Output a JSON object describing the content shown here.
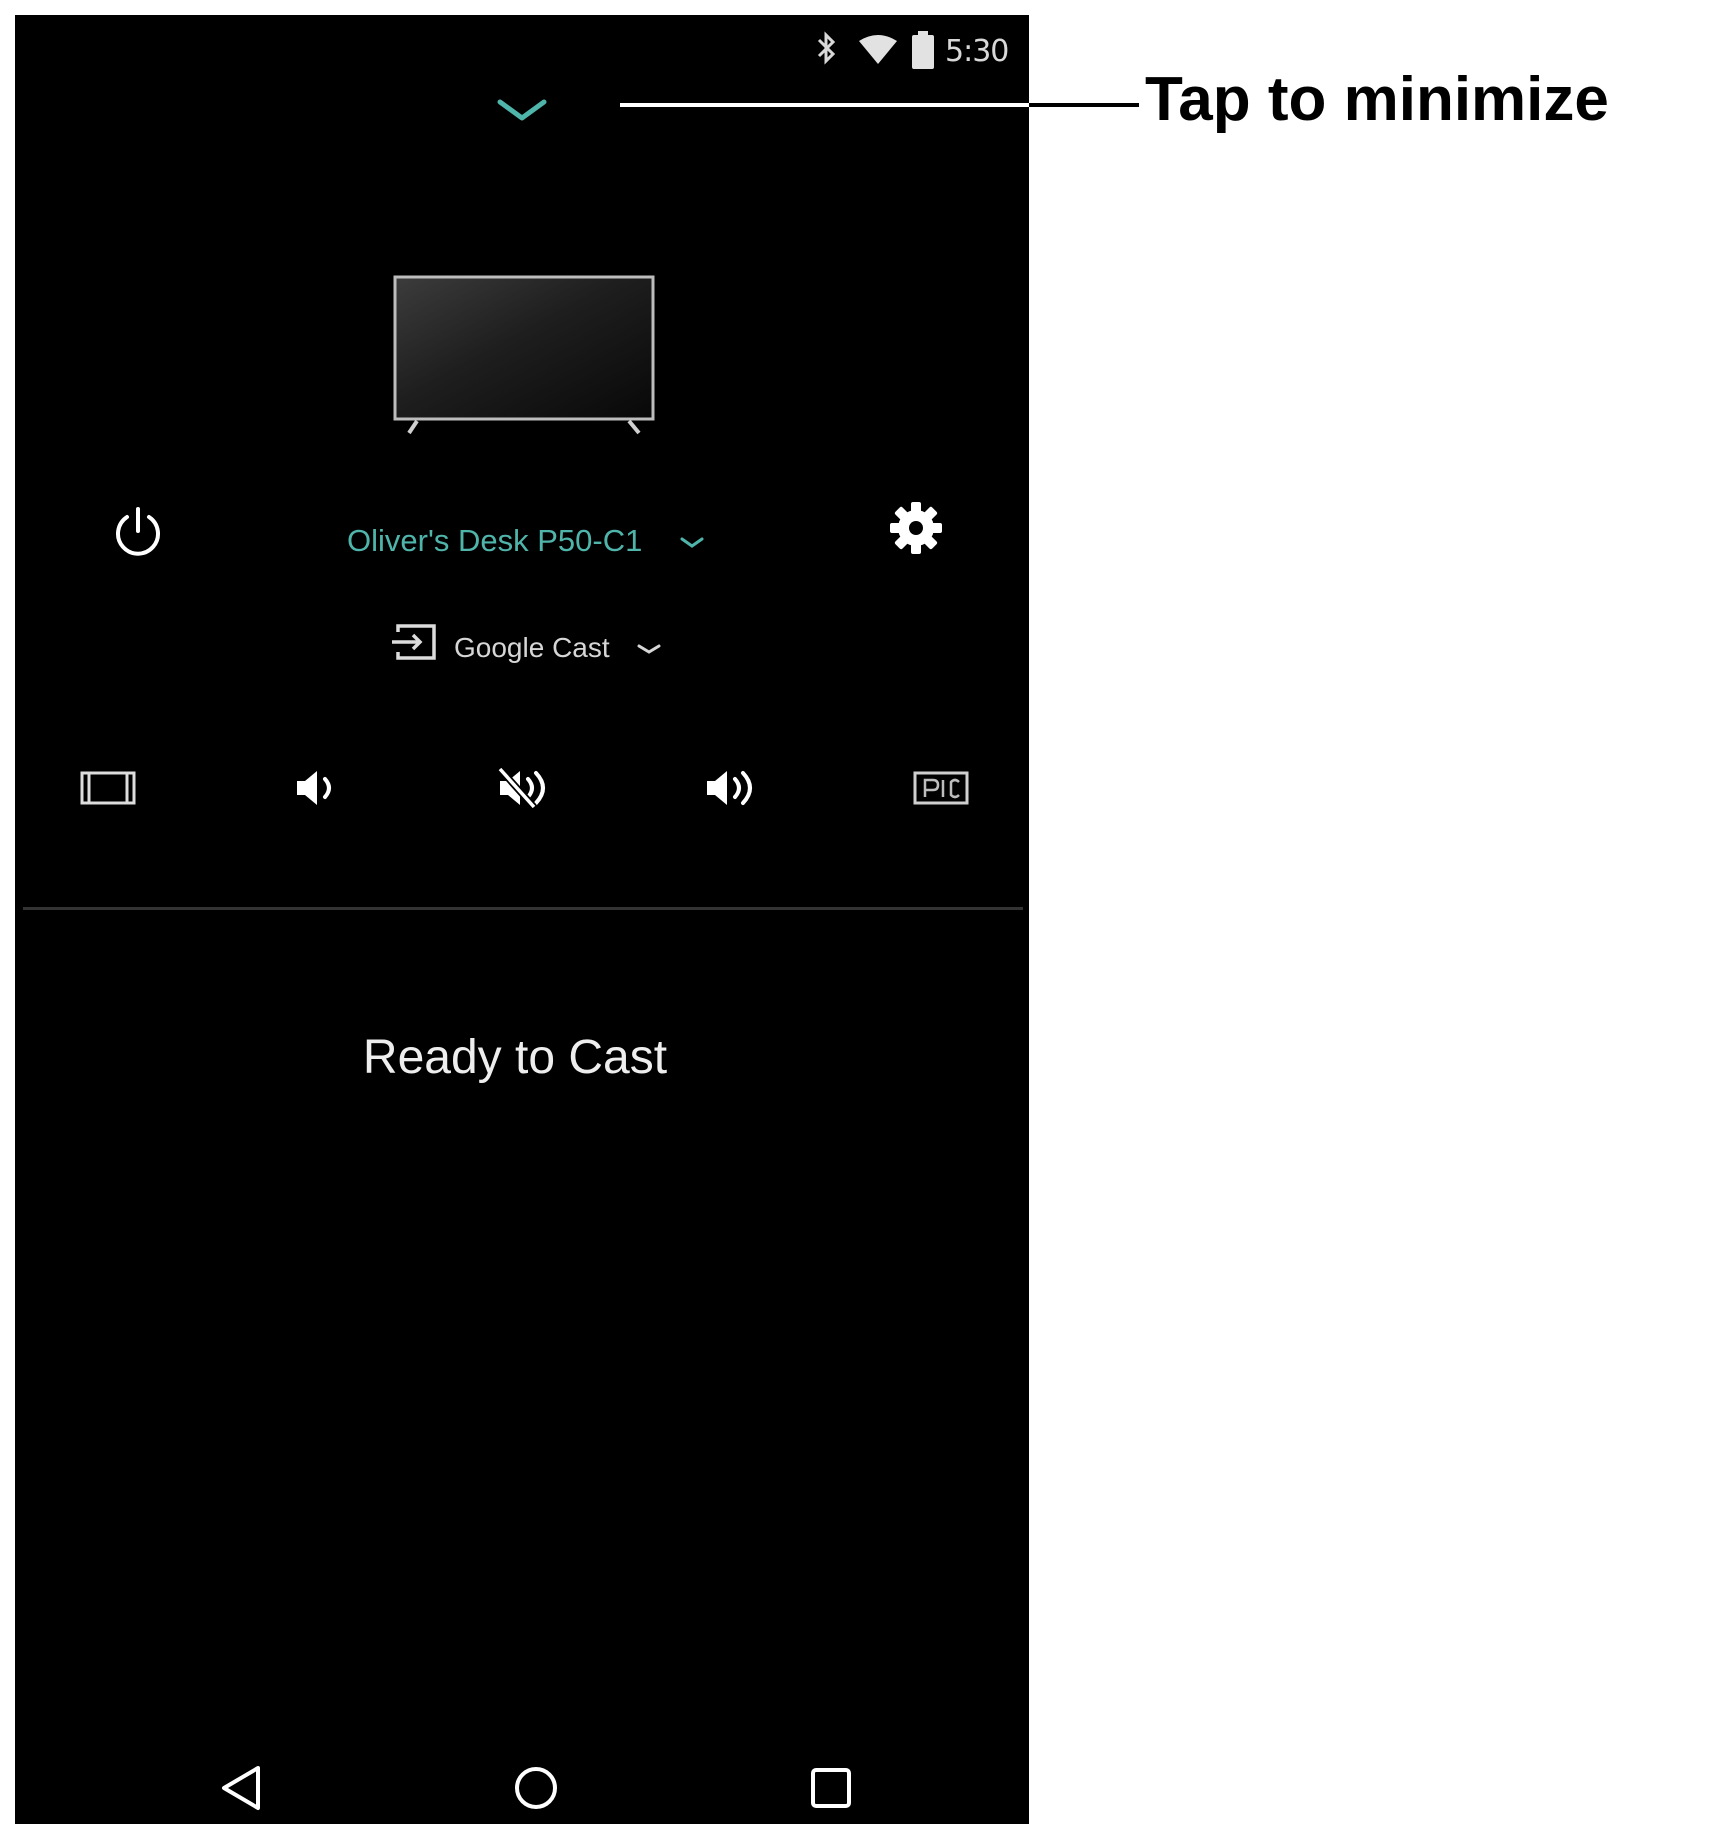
{
  "status_bar": {
    "time": "5:30",
    "icons": [
      "bluetooth-icon",
      "wifi-icon",
      "battery-icon"
    ]
  },
  "callout": {
    "label": "Tap to minimize"
  },
  "device": {
    "name": "Oliver's Desk P50-C1",
    "input": "Google Cast"
  },
  "controls": {
    "items": [
      "aspect-ratio-icon",
      "volume-down-icon",
      "mute-icon",
      "volume-up-icon",
      "picture-mode-icon"
    ]
  },
  "main": {
    "status": "Ready to Cast"
  },
  "nav_bar": {
    "items": [
      "back-icon",
      "home-icon",
      "recents-icon"
    ]
  },
  "colors": {
    "accent": "#4fb5ab",
    "background": "#000000"
  }
}
